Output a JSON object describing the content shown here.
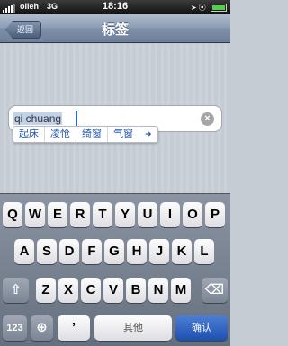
{
  "status_bar": {
    "carrier": "olleh",
    "network": "3G",
    "time": "18:16",
    "indicators": "➤ ⦿"
  },
  "nav": {
    "back_label": "返回",
    "title": "标签"
  },
  "field": {
    "value": "qi chuang",
    "clear_glyph": "×"
  },
  "candidates": [
    "起床",
    "凌怆",
    "绮窗",
    "气窗"
  ],
  "candidates_more_glyph": "➜",
  "keyboard": {
    "row1": [
      "Q",
      "W",
      "E",
      "R",
      "T",
      "Y",
      "U",
      "I",
      "O",
      "P"
    ],
    "row2": [
      "A",
      "S",
      "D",
      "F",
      "G",
      "H",
      "J",
      "K",
      "L"
    ],
    "row3": [
      "Z",
      "X",
      "C",
      "V",
      "B",
      "N",
      "M"
    ],
    "shift_glyph": "⇧",
    "delete_glyph": "⌫",
    "numbers_label": "123",
    "globe_glyph": "⊕",
    "apostrophe_label": "’",
    "space_label": "其他",
    "return_label": "确认"
  }
}
